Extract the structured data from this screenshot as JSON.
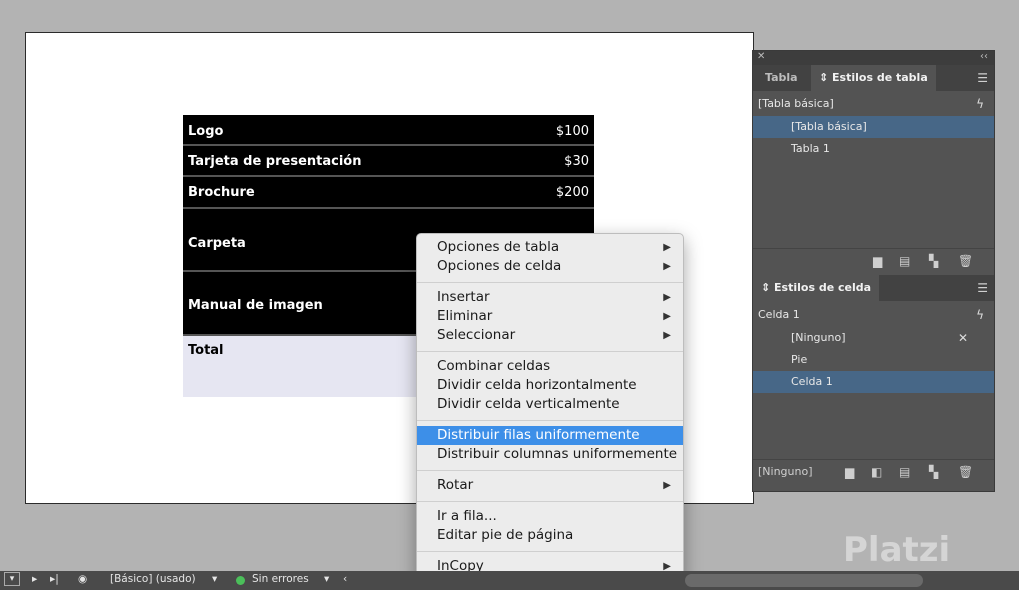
{
  "table": {
    "rows": [
      {
        "label": "Logo",
        "price": "$100"
      },
      {
        "label": "Tarjeta de presentación",
        "price": "$30"
      },
      {
        "label": "Brochure",
        "price": "$200"
      },
      {
        "label": "Carpeta",
        "price": ""
      },
      {
        "label": "Manual de imagen",
        "price": ""
      },
      {
        "label": "Total",
        "price": ""
      }
    ]
  },
  "panel": {
    "tabs": [
      "Tabla",
      "Estilos de tabla"
    ],
    "table_styles": {
      "current": "[Tabla básica]",
      "items": [
        "[Tabla básica]",
        "Tabla 1"
      ]
    },
    "cell_styles": {
      "title": "Estilos de celda",
      "current": "Celda 1",
      "items": [
        "[Ninguno]",
        "Pie",
        "Celda 1"
      ],
      "footer_label": "[Ninguno]"
    }
  },
  "context_menu": {
    "items": [
      {
        "label": "Opciones de tabla",
        "submenu": true
      },
      {
        "label": "Opciones de celda",
        "submenu": true
      },
      {
        "label": "Insertar",
        "submenu": true
      },
      {
        "label": "Eliminar",
        "submenu": true
      },
      {
        "label": "Seleccionar",
        "submenu": true
      },
      {
        "label": "Combinar celdas",
        "submenu": false
      },
      {
        "label": "Dividir celda horizontalmente",
        "submenu": false
      },
      {
        "label": "Dividir celda verticalmente",
        "submenu": false
      },
      {
        "label": "Distribuir filas uniformemente",
        "submenu": false,
        "highlighted": true
      },
      {
        "label": "Distribuir columnas uniformemente",
        "submenu": false
      },
      {
        "label": "Rotar",
        "submenu": true
      },
      {
        "label": "Ir a fila...",
        "submenu": false
      },
      {
        "label": "Editar pie de página",
        "submenu": false
      },
      {
        "label": "InCopy",
        "submenu": true
      }
    ]
  },
  "statusbar": {
    "style_label": "[Básico] (usado)",
    "preflight": "Sin errores"
  },
  "watermark": "Platzi",
  "colors": {
    "highlight": "#3d8fe8",
    "selected_row": "#476787",
    "ok_green": "#4bbf5a"
  }
}
